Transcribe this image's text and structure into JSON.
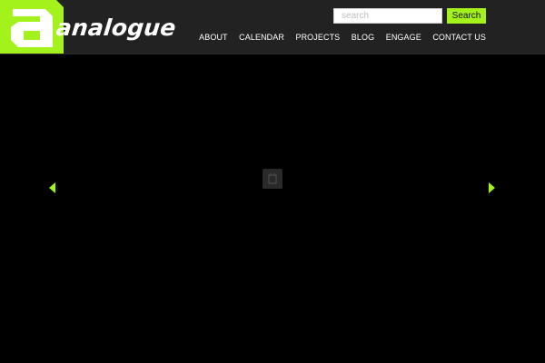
{
  "site": {
    "logo_text": "analogue"
  },
  "search": {
    "placeholder": "search",
    "button_label": "Search"
  },
  "nav": {
    "items": [
      {
        "label": "ABOUT"
      },
      {
        "label": "CALENDAR"
      },
      {
        "label": "PROJECTS"
      },
      {
        "label": "BLOG"
      },
      {
        "label": "ENGAGE"
      },
      {
        "label": "CONTACT US"
      }
    ]
  },
  "slider": {
    "prev_icon": "triangle-left-icon",
    "next_icon": "triangle-right-icon",
    "loading_icon": "spinner-icon"
  },
  "colors": {
    "accent": "#a4f21c",
    "header_bg": "#222222",
    "page_bg": "#000000"
  }
}
